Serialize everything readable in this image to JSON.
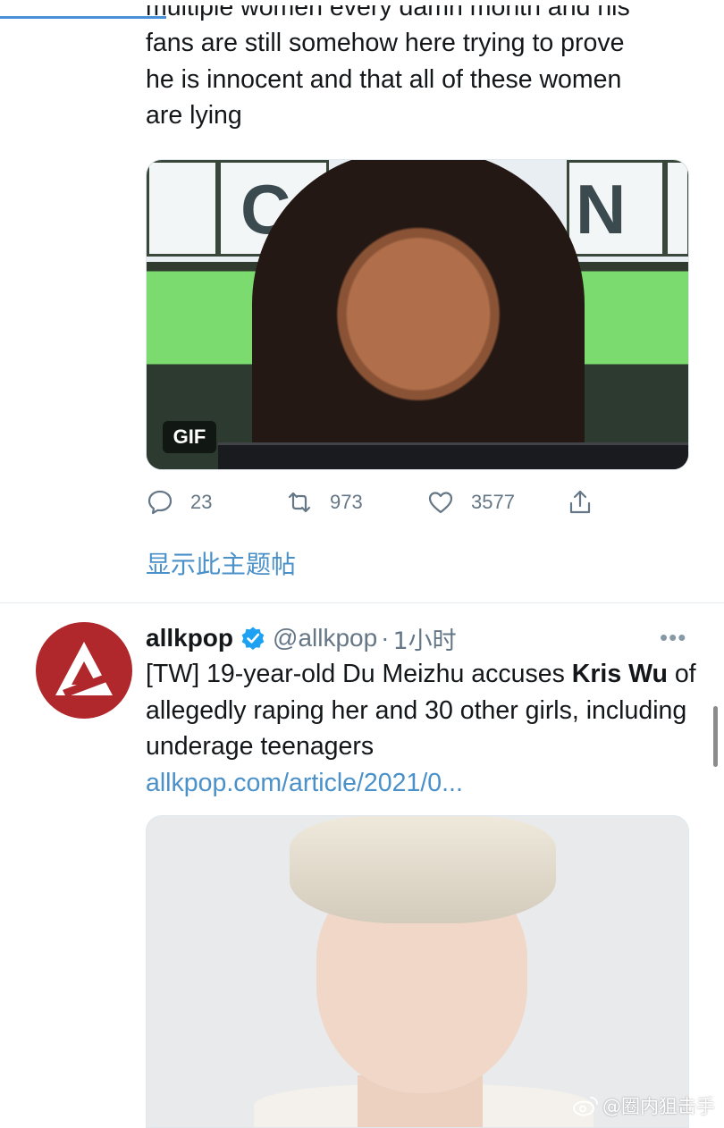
{
  "tweet1": {
    "text_cut_line": "multiple women every damn month and his",
    "text_lines": [
      "fans are still somehow here trying to prove",
      "he is innocent and that all of these women",
      "are lying"
    ],
    "media": {
      "type": "gif",
      "badge": "GIF",
      "tile_letters": [
        "C",
        "N"
      ]
    },
    "actions": {
      "reply_count": "23",
      "retweet_count": "973",
      "like_count": "3577"
    },
    "show_thread": "显示此主题帖"
  },
  "tweet2": {
    "display_name": "allkpop",
    "handle": "@allkpop",
    "separator": "·",
    "time": "1小时",
    "more": "•••",
    "text_before_bold": "[TW] 19-year-old Du Meizhu accuses ",
    "text_bold": "Kris Wu",
    "text_after_bold": " of allegedly raping her and 30 other girls, including underage teenagers",
    "link": "allkpop.com/article/2021/0..."
  },
  "watermark": {
    "text": "@圈内狙击手",
    "icon": "weibo-icon"
  },
  "colors": {
    "link": "#4a90c9",
    "muted": "#657786",
    "verified": "#1da1f2",
    "avatar_bg": "#b0282b"
  }
}
